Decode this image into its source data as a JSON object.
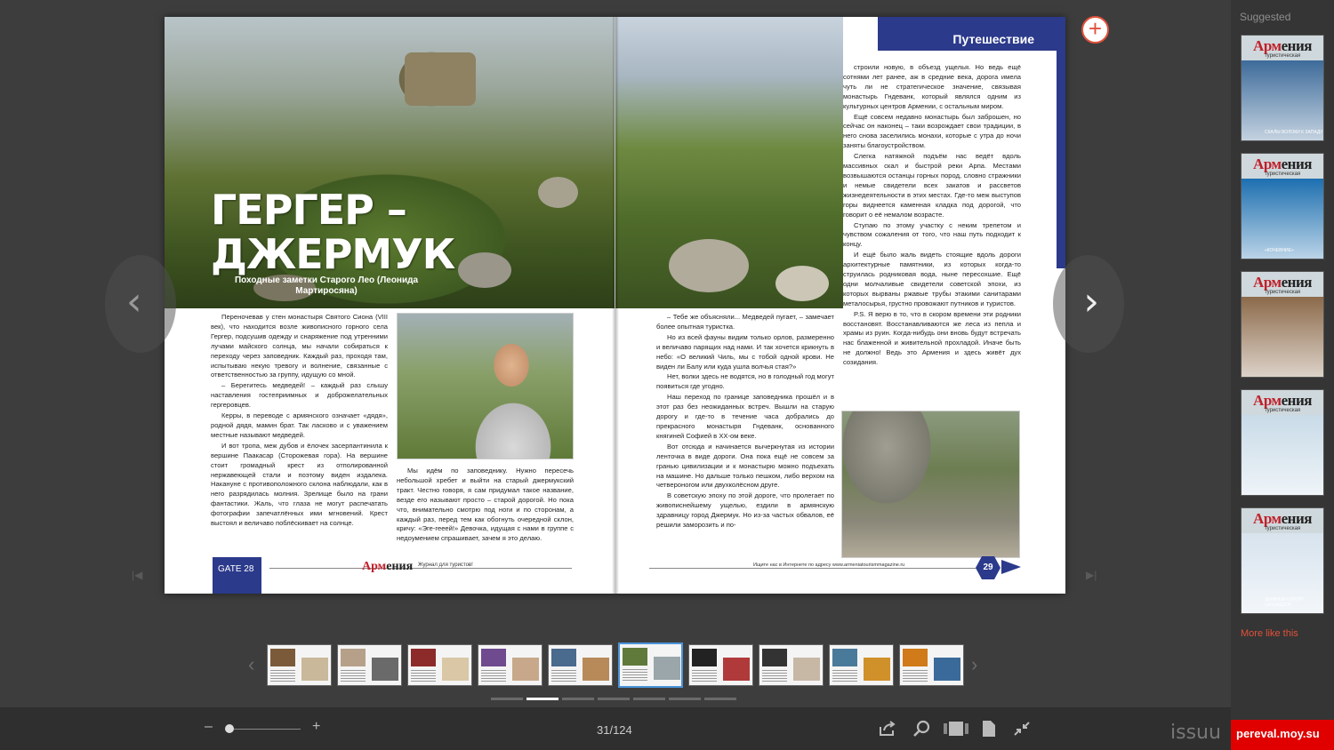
{
  "sidebar": {
    "title": "Suggested",
    "more_like": "More like this",
    "items": [
      {
        "logo_a": "Арм",
        "logo_b": "ения",
        "sub": "туристическая",
        "caption": "СКАЛЫ ВОЛОКИ К ЗАПАДУ",
        "accent": "#3d6b9a"
      },
      {
        "logo_a": "Арм",
        "logo_b": "ения",
        "sub": "туристическая",
        "caption": "«КОЧЕВНИЕ»",
        "accent": "#1d6fb0"
      },
      {
        "logo_a": "Арм",
        "logo_b": "ения",
        "sub": "туристическая",
        "caption": "",
        "accent": "#8c6a4a"
      },
      {
        "logo_a": "Арм",
        "logo_b": "ения",
        "sub": "туристическая",
        "caption": "",
        "accent": "#c9dbe8"
      },
      {
        "logo_a": "Арм",
        "logo_b": "ения",
        "sub": "туристическая",
        "caption": "ДЫМНЫЙ КУРОРТ ЦАХКАДЗОР",
        "accent": "#d7e3ee"
      }
    ]
  },
  "spread": {
    "headline": "ГЕРГЕР – ДЖЕРМУК",
    "subhead": "Походные заметки Старого Лео (Леонида Мартиросяна)",
    "rubric": "Путешествие",
    "left_col1": [
      "Переночевав у стен монастыря Святого Сиона (VIII век), что находится возле живописного горного села Гергер, подсушив одежду и снаряжение под утренними лучами майского солнца, мы начали собираться к переходу через заповедник. Каждый раз, проходя там, испытываю некую тревогу и волнение, связанные с ответственностью за группу, идущую со мной.",
      "– Берегитесь медведей! – каждый раз слышу наставления гостеприимных и доброжелательных гергеровцев.",
      "Керры, в переводе с армянского означает «дядя», родной дядя, мамин брат. Так ласково и с уважением местные называют медведей.",
      "И вот тропа, меж дубов и ёлочек засерпантинила к вершине Паакасар (Сторожевая гора). На вершине стоит громадный крест из отполированной нержавеющей стали и поэтому виден издалека. Накануне с противоположного склона наблюдали, как в него разрядилась молния. Зрелище было на грани фантастики. Жаль, что глаза не могут распечатать фотографии запечатлённых ими мгновений. Крест выстоял и величаво поблёскивает на солнце."
    ],
    "left_col2": [
      "Мы идём по заповеднику. Нужно пересечь небольшой хребет и выйти на старый джермукский тракт. Честно говоря, я сам придумал такое название, везде его называют просто – старой дорогой. Но пока что, внимательно смотрю под ноги и по сторонам, а каждый раз, перед тем как обогнуть очередной склон, кричу: «Эге-гееей!» Девочка, идущая с нами в группе с недоумением спрашивает, зачем я это делаю."
    ],
    "right_col1": [
      "– Тебе же объясняли... Медведей пугает, – замечает более опытная туристка.",
      "Но из всей фауны видим только орлов, размеренно и величаво парящих над нами. И так хочется крикнуть в небо: «О великий Чиль, мы с тобой одной крови. Не виден ли Балу или куда ушла волчья стая?»",
      "Нет, волки здесь не водятся, но в голодный год могут появиться где угодно.",
      "Наш переход по границе заповедника прошёл и в этот раз без неожиданных встреч. Вышли на старую дорогу и где-то в течение часа добрались до прекрасного монастыря Гндеванк, основанного княгиней Софией в XX-ом веке.",
      "Вот отсюда и начинается вычеркнутая из истории ленточка в виде дороги. Она пока ещё не совсем за гранью цивилизации и к монастырю можно подъехать на машине. Но дальше только пешком, либо верхом на четвероногом или двухколёсном друге.",
      "В советскую эпоху по этой дороге, что пролегает по живописнейшему ущелью, ездили в армянскую здравницу город Джермук. Но из-за частых обвалов, её решили заморозить и по-"
    ],
    "right_col2": [
      "строили новую, в объезд ущелья. Но ведь ещё сотнями лет ранее, аж в средние века, дорога имела чуть ли не стратегическое значение, связывая монастырь Гндеванк, который являлся одним из культурных центров Армении, с остальным миром.",
      "Ещё совсем недавно монастырь был заброшен, но сейчас он наконец – таки возрождает свои традиции, в него снова заселились монахи, которые с утра до ночи заняты благоустройством.",
      "Слегка натяжной подъём нас ведёт вдоль массивных скал и быстрой реки Арпа. Местами возвышаются останцы горных пород, словно стражники и немые свидетели всех закатов и рассветов жизнедеятельности в этих местах. Где-то меж выступов горы виднеется каменная кладка под дорогой, что говорит о её немалом возрасте.",
      "Ступаю по этому участку с неким трепетом и чувством сожаления от того, что наш путь подходит к концу.",
      "И ещё было жаль видеть стоящие вдоль дороги архитектурные памятники, из которых когда-то струилась родниковая вода, ныне пересохшие. Ещё одни молчаливые свидетели советской эпохи, из которых вырваны ржавые трубы этакими санитарами металосырья, грустно провожают путников и туристов.",
      "P.S. Я верю в то, что в скором времени эти родники восстановят. Восстанавливаются же леса из пепла и храмы из руин. Когда-нибудь они вновь будут встречать нас блаженной и живительной прохладой. Иначе быть не должно! Ведь это Армения и здесь живёт дух созидания."
    ],
    "footer_left_badge": "GATE 28",
    "footer_logo_a": "Арм",
    "footer_logo_b": "ения",
    "footer_tagline": "Журнал для туристов!",
    "footer_right_text": "Ищите нас в Интернете по адресу www.armeniatourismmagazine.ru",
    "right_page_number": "29"
  },
  "nav": {
    "prev": "‹",
    "next": "›",
    "add": "+"
  },
  "toolbar": {
    "zoom_out": "–",
    "zoom_in": "+",
    "zoom_level": 0.05,
    "page_indicator": "31/124",
    "brand": "issuu"
  },
  "thumbnails": {
    "count": 10,
    "active_index": 5,
    "dots": 7,
    "active_dot": 1
  },
  "watermark": "pereval.moy.su",
  "colors": {
    "accent_blue": "#2b3a8b",
    "issuu_orange": "#e0513c",
    "active_thumb": "#4b93d8"
  }
}
